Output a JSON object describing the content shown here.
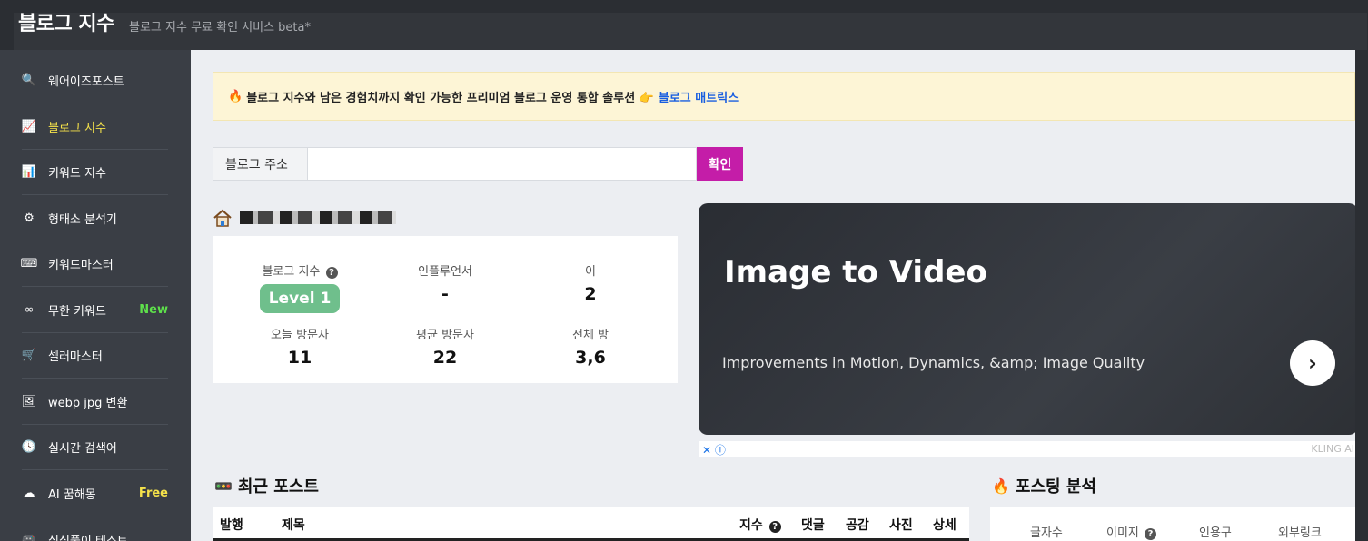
{
  "header": {
    "brand": "블로그 지수",
    "tagline": "블로그 지수 무료 확인 서비스 beta*"
  },
  "sidebar": {
    "items": [
      {
        "label": "웨어이즈포스트",
        "icon": "search-icon",
        "glyph": "🔍"
      },
      {
        "label": "블로그 지수",
        "icon": "chart-line-icon",
        "glyph": "📈",
        "active": true
      },
      {
        "label": "키워드 지수",
        "icon": "bar-chart-icon",
        "glyph": "📊"
      },
      {
        "label": "형태소 분석기",
        "icon": "gear-icon",
        "glyph": "⚙"
      },
      {
        "label": "키워드마스터",
        "icon": "keyboard-icon",
        "glyph": "⌨"
      },
      {
        "label": "무한 키워드",
        "icon": "infinity-icon",
        "glyph": "∞",
        "badge": "New"
      },
      {
        "label": "셀러마스터",
        "icon": "cart-icon",
        "glyph": "🛒"
      },
      {
        "label": "webp jpg 변환",
        "icon": "image-icon",
        "glyph": "🖼"
      },
      {
        "label": "실시간 검색어",
        "icon": "clock-icon",
        "glyph": "🕓"
      },
      {
        "label": "AI 꿈해몽",
        "icon": "cloud-icon",
        "glyph": "☁",
        "badge": "Free"
      },
      {
        "label": "심심풀이 테스트",
        "icon": "gamepad-icon",
        "glyph": "🎮"
      }
    ]
  },
  "notice": {
    "text": "블로그 지수와 남은 경험치까지 확인 가능한 프리미엄 블로그 운영 통합 솔루션 👉",
    "link": "블로그 매트릭스"
  },
  "search": {
    "label": "블로그 주소",
    "button": "확인"
  },
  "stats": {
    "blog_index_label": "블로그 지수",
    "blog_index_value": "Level 1",
    "influencer_label": "인플루언서",
    "influencer_value": "-",
    "third_label": "이",
    "third_value": "2",
    "today_label": "오늘 방문자",
    "today_value": "11",
    "avg_label": "평균 방문자",
    "avg_value": "22",
    "total_label": "전체 방",
    "total_value": "3,6"
  },
  "ad": {
    "title": "Image to Video",
    "subtitle": "Improvements in Motion, Dynamics, &amp; Image Quality",
    "brand": "KLING AI"
  },
  "recent_posts": {
    "title": "최근 포스트",
    "columns": [
      "발행",
      "제목",
      "지수",
      "댓글",
      "공감",
      "사진",
      "상세"
    ]
  },
  "posting_analysis": {
    "title": "포스팅 분석",
    "columns": [
      "글자수",
      "이미지",
      "인용구",
      "외부링크"
    ]
  }
}
